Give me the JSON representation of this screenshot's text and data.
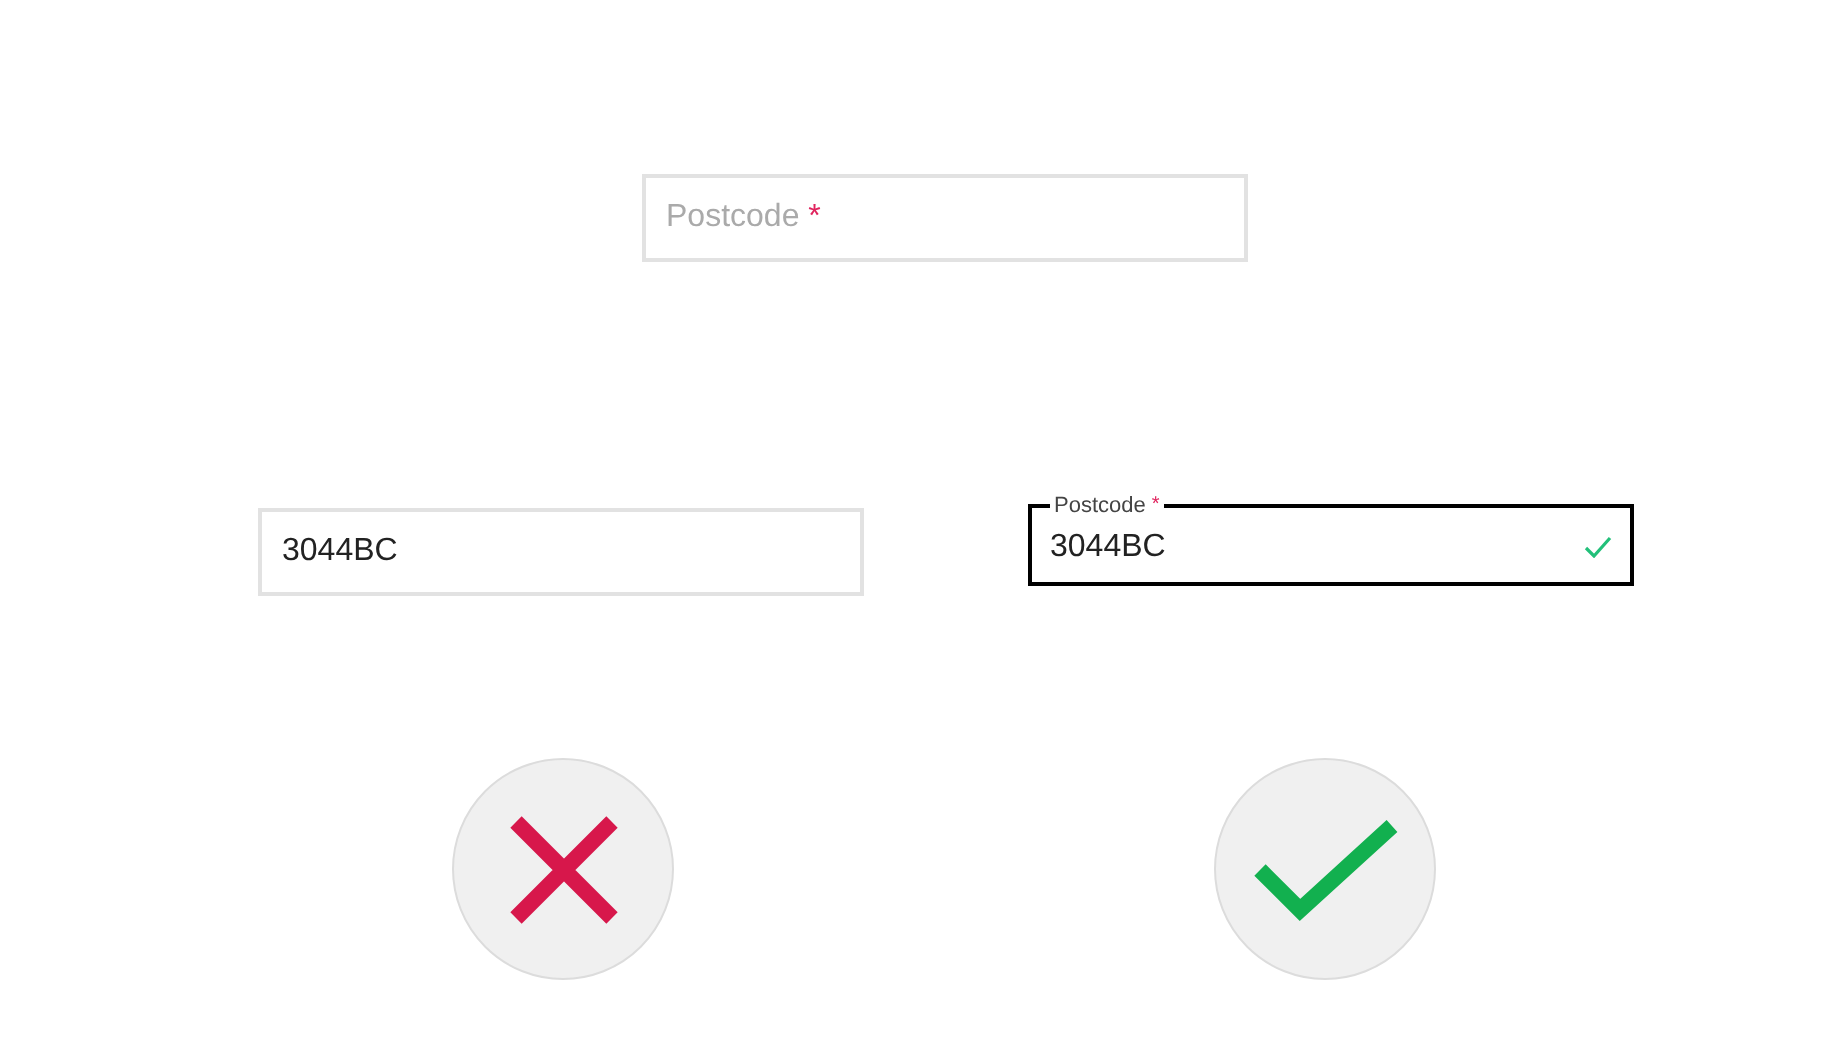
{
  "fields": [
    {
      "label": "Postcode",
      "required_mark": "*",
      "floating": false,
      "valid": false
    },
    {
      "value": "3044BC",
      "floating": false,
      "valid": false
    },
    {
      "label": "Postcode",
      "required_mark": "*",
      "value": "3044BC",
      "floating": true,
      "valid": true
    }
  ],
  "results": [
    {
      "kind": "cross"
    },
    {
      "kind": "check"
    }
  ]
}
